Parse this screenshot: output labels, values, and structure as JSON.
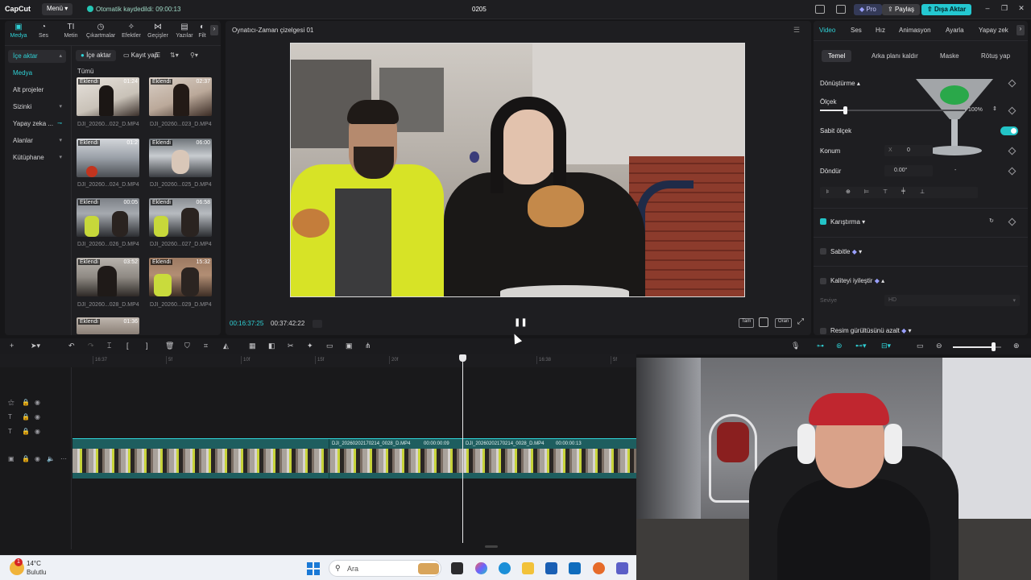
{
  "titlebar": {
    "logo": "CapCut",
    "menu_label": "Menü",
    "autosave_text": "Otomatik kaydedildi: 09:00:13",
    "project_name": "0205",
    "pro_label": "Pro",
    "share_label": "Paylaş",
    "export_label": "Dışa Aktar",
    "minimize_icon": "minimize-icon",
    "maximize_icon": "maximize-icon",
    "close_icon": "close-icon"
  },
  "left_panel": {
    "tabs": [
      {
        "label": "Medya",
        "icon": "media-icon"
      },
      {
        "label": "Ses",
        "icon": "audio-icon"
      },
      {
        "label": "Metin",
        "icon": "text-icon"
      },
      {
        "label": "Çıkartmalar",
        "icon": "sticker-icon"
      },
      {
        "label": "Efektler",
        "icon": "effects-icon"
      },
      {
        "label": "Geçişler",
        "icon": "transitions-icon"
      },
      {
        "label": "Yazılar",
        "icon": "captions-icon"
      },
      {
        "label": "Filt",
        "icon": "filters-icon"
      }
    ],
    "side_items": [
      {
        "label": "İçe aktar"
      },
      {
        "label": "Medya"
      },
      {
        "label": "Alt projeler"
      },
      {
        "label": "Sizinki"
      },
      {
        "label": "Yapay zeka ..."
      },
      {
        "label": "Alanlar"
      },
      {
        "label": "Kütüphane"
      }
    ],
    "import_button": "İçe aktar",
    "record_button": "Kayıt yap",
    "section_label": "Tümü",
    "media_items": [
      {
        "badge": "Eklendi",
        "duration": "01:24",
        "name": "DJI_20260...022_D.MP4"
      },
      {
        "badge": "Eklendi",
        "duration": "02:37",
        "name": "DJI_20260...023_D.MP4"
      },
      {
        "badge": "Eklendi",
        "duration": "01:2",
        "name": "DJI_20260...024_D.MP4"
      },
      {
        "badge": "Eklendi",
        "duration": "06:00",
        "name": "DJI_20260...025_D.MP4"
      },
      {
        "badge": "Eklendi",
        "duration": "00:05",
        "name": "DJI_20260...026_D.MP4"
      },
      {
        "badge": "Eklendi",
        "duration": "06:58",
        "name": "DJI_20260...027_D.MP4"
      },
      {
        "badge": "Eklendi",
        "duration": "03:52",
        "name": "DJI_20260...028_D.MP4"
      },
      {
        "badge": "Eklendi",
        "duration": "15:32",
        "name": "DJI_20260...029_D.MP4"
      },
      {
        "badge": "Eklendi",
        "duration": "01:36",
        "name": ""
      }
    ]
  },
  "player": {
    "title": "Oynatıcı-Zaman çizelgesi 01",
    "current_time": "00:16:37:25",
    "total_time": "00:37:42:22",
    "controls": [
      "Tam",
      "Oran"
    ]
  },
  "right_panel": {
    "tabs": [
      "Video",
      "Ses",
      "Hız",
      "Animasyon",
      "Ayarla",
      "Yapay zek"
    ],
    "subtabs": [
      "Temel",
      "Arka planı kaldır",
      "Maske",
      "Rötuş yap"
    ],
    "transform_label": "Dönüştürme",
    "scale_label": "Ölçek",
    "scale_value": "100%",
    "scale_fraction": 0.17,
    "uniform_scale_label": "Sabit ölçek",
    "position_label": "Konum",
    "position_x_label": "X",
    "position_x_value": "0",
    "rotate_label": "Döndür",
    "rotate_value": "0.00°",
    "rotate_dash": "-",
    "blend_label": "Karıştırma",
    "stabilize_label": "Sabitle",
    "enhance_label": "Kaliteyi iyileştir",
    "level_label": "Seviye",
    "level_value": "HD",
    "denoise_label": "Resim gürültüsünü azalt"
  },
  "timeline": {
    "ticks": [
      "16:37",
      "5f",
      "10f",
      "15f",
      "20f",
      "16:38",
      "5f"
    ],
    "clips": [
      {
        "name": "DJI_20260202170214_0028_D.MP4",
        "duration": "00:00:00:09"
      },
      {
        "name": "DJI_20260202170214_0028_D.MP4",
        "duration": "00:00:00:13"
      }
    ]
  },
  "taskbar": {
    "weather_badge": "1",
    "weather_temp": "14°C",
    "weather_desc": "Bulutlu",
    "search_placeholder": "Ara"
  },
  "colors": {
    "accent": "#2fd1d6",
    "export": "#24c8d1",
    "clip": "#1e5e5f"
  }
}
